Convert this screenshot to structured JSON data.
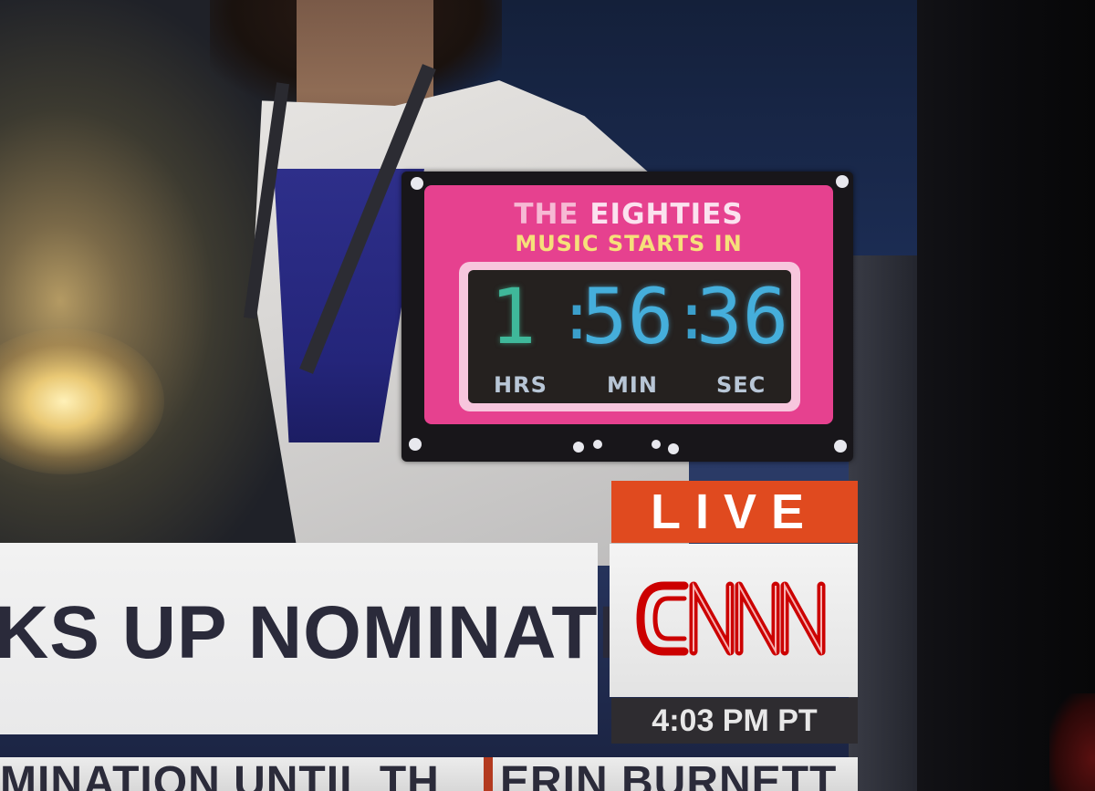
{
  "countdown": {
    "title_part1": "THE ",
    "title_part2": "EIGHTIES",
    "subtitle": "MUSIC STARTS IN",
    "hours": "1",
    "minutes": "56",
    "seconds": "36",
    "label_hours": "HRS",
    "label_minutes": "MIN",
    "label_seconds": "SEC",
    "colors": {
      "face": "#e6418f",
      "digits": "#45aedb",
      "hours_digit": "#3fb89a"
    }
  },
  "lower_third": {
    "headline": "KS UP NOMINATION",
    "live_label": "LIVE",
    "network_logo": "CNN",
    "time": "4:03 PM PT",
    "ticker_left": "MINATION UNTIL TH",
    "ticker_right": "ERIN BURNETT",
    "colors": {
      "live": "#e04a1f",
      "logo_red": "#cc0000"
    }
  }
}
